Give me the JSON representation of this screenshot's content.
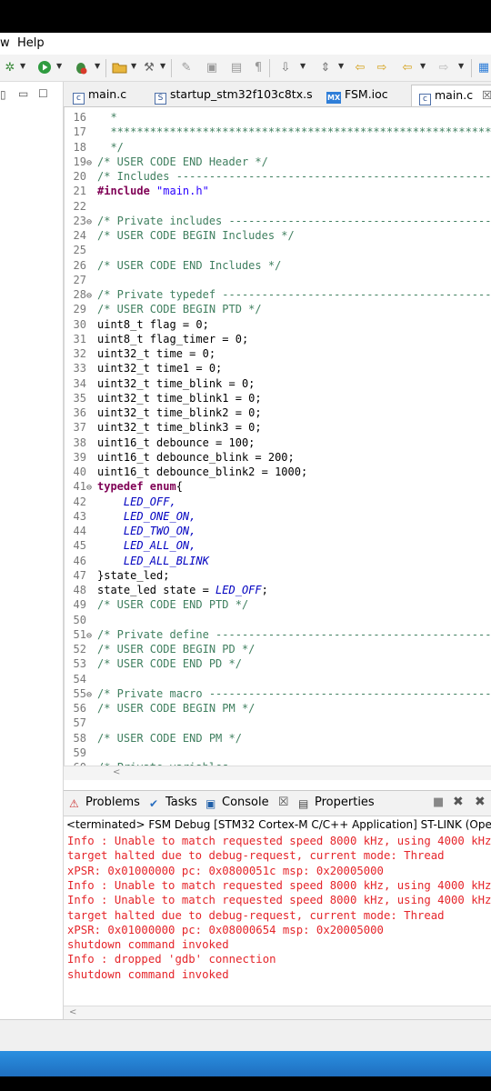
{
  "menu": {
    "item_partial": "w",
    "help": "Help"
  },
  "tabs": [
    {
      "label": "main.c",
      "icon": "c-file-icon"
    },
    {
      "label": "startup_stm32f103c8tx.s",
      "icon": "asm-file-icon"
    },
    {
      "label": "FSM.ioc",
      "icon": "mx-file-icon"
    },
    {
      "label": "main.c",
      "icon": "c-file-icon",
      "active": true,
      "close": "☒"
    }
  ],
  "left_panel": {
    "minimize": "▭",
    "maximize": "☐"
  },
  "code": {
    "lines": [
      {
        "n": "16",
        "t": "  *",
        "cls": "c-comment"
      },
      {
        "n": "17",
        "t": "  ***************************************************************",
        "cls": "c-comment"
      },
      {
        "n": "18",
        "t": "  */",
        "cls": "c-comment"
      },
      {
        "n": "19",
        "fold": "⊖",
        "t": "/* USER CODE END Header */",
        "cls": "c-comment"
      },
      {
        "n": "20",
        "t": "/* Includes ------------------------------------------------",
        "cls": "c-comment"
      },
      {
        "n": "21",
        "kw": "#include ",
        "str": "\"main.h\""
      },
      {
        "n": "22",
        "t": ""
      },
      {
        "n": "23",
        "fold": "⊖",
        "t": "/* Private includes -----------------------------------------",
        "cls": "c-comment"
      },
      {
        "n": "24",
        "t": "/* USER CODE BEGIN Includes */",
        "cls": "c-comment"
      },
      {
        "n": "25",
        "t": ""
      },
      {
        "n": "26",
        "t": "/* USER CODE END Includes */",
        "cls": "c-comment"
      },
      {
        "n": "27",
        "t": ""
      },
      {
        "n": "28",
        "fold": "⊖",
        "t": "/* Private typedef -------------------------------------------",
        "cls": "c-comment"
      },
      {
        "n": "29",
        "t": "/* USER CODE BEGIN PTD */",
        "cls": "c-comment"
      },
      {
        "n": "30",
        "t": "uint8_t flag = 0;",
        "cls": "c-plain"
      },
      {
        "n": "31",
        "t": "uint8_t flag_timer = 0;",
        "cls": "c-plain"
      },
      {
        "n": "32",
        "t": "uint32_t time = 0;",
        "cls": "c-plain"
      },
      {
        "n": "33",
        "t": "uint32_t time1 = 0;",
        "cls": "c-plain"
      },
      {
        "n": "34",
        "t": "uint32_t time_blink = 0;",
        "cls": "c-plain"
      },
      {
        "n": "35",
        "t": "uint32_t time_blink1 = 0;",
        "cls": "c-plain"
      },
      {
        "n": "36",
        "t": "uint32_t time_blink2 = 0;",
        "cls": "c-plain"
      },
      {
        "n": "37",
        "t": "uint32_t time_blink3 = 0;",
        "cls": "c-plain"
      },
      {
        "n": "38",
        "t": "uint16_t debounce = 100;",
        "cls": "c-plain"
      },
      {
        "n": "39",
        "t": "uint16_t debounce_blink = 200;",
        "cls": "c-plain"
      },
      {
        "n": "40",
        "t": "uint16_t debounce_blink2 = 1000;",
        "cls": "c-plain"
      },
      {
        "n": "41",
        "fold": "⊖",
        "kw": "typedef enum",
        "t": "{",
        "cls": "c-plain"
      },
      {
        "n": "42",
        "t": "    LED_OFF,",
        "cls": "c-enum"
      },
      {
        "n": "43",
        "t": "    LED_ONE_ON,",
        "cls": "c-enum"
      },
      {
        "n": "44",
        "t": "    LED_TWO_ON,",
        "cls": "c-enum"
      },
      {
        "n": "45",
        "t": "    LED_ALL_ON,",
        "cls": "c-enum"
      },
      {
        "n": "46",
        "t": "    LED_ALL_BLINK",
        "cls": "c-enum"
      },
      {
        "n": "47",
        "t": "}state_led;",
        "cls": "c-plain"
      },
      {
        "n": "48",
        "t": "state_led state = ",
        "cls": "c-plain",
        "tail": "LED_OFF",
        "tail_cls": "c-enum",
        "end": ";"
      },
      {
        "n": "49",
        "t": "/* USER CODE END PTD */",
        "cls": "c-comment"
      },
      {
        "n": "50",
        "t": ""
      },
      {
        "n": "51",
        "fold": "⊖",
        "t": "/* Private define -------------------------------------------",
        "cls": "c-comment"
      },
      {
        "n": "52",
        "t": "/* USER CODE BEGIN PD */",
        "cls": "c-comment"
      },
      {
        "n": "53",
        "t": "/* USER CODE END PD */",
        "cls": "c-comment"
      },
      {
        "n": "54",
        "t": ""
      },
      {
        "n": "55",
        "fold": "⊖",
        "t": "/* Private macro ---------------------------------------------",
        "cls": "c-comment"
      },
      {
        "n": "56",
        "t": "/* USER CODE BEGIN PM */",
        "cls": "c-comment"
      },
      {
        "n": "57",
        "t": ""
      },
      {
        "n": "58",
        "t": "/* USER CODE END PM */",
        "cls": "c-comment"
      },
      {
        "n": "59",
        "t": ""
      },
      {
        "n": "60",
        "t": "/* Private variables",
        "cls": "c-comment"
      }
    ]
  },
  "console": {
    "tabs": [
      "Problems",
      "Tasks",
      "Console",
      "Properties"
    ],
    "console_close": "☒",
    "title": "<terminated> FSM Debug [STM32 Cortex-M C/C++ Application] ST-LINK (OpenOCD)",
    "lines": [
      "Info : Unable to match requested speed 8000 kHz, using 4000 kHz",
      "target halted due to debug-request, current mode: Thread",
      "xPSR: 0x01000000 pc: 0x0800051c msp: 0x20005000",
      "Info : Unable to match requested speed 8000 kHz, using 4000 kHz",
      "Info : Unable to match requested speed 8000 kHz, using 4000 kHz",
      "target halted due to debug-request, current mode: Thread",
      "xPSR: 0x01000000 pc: 0x08000654 msp: 0x20005000",
      "shutdown command invoked",
      "Info : dropped 'gdb' connection",
      "shutdown command invoked"
    ]
  },
  "scroll": {
    "left_arrow": "<"
  }
}
